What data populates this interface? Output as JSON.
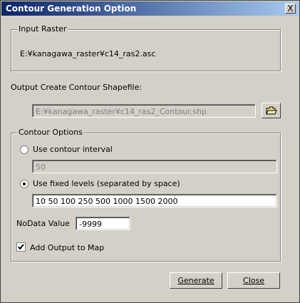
{
  "window": {
    "title": "Contour Generation Option",
    "close_glyph": "X"
  },
  "input_raster": {
    "group_title": "Input Raster",
    "path": "E:¥kanagawa_raster¥c14_ras2.asc"
  },
  "output": {
    "label": "Output Create Contour Shapefile:",
    "path": "E:¥kanagawa_raster¥c14_ras2_Contour.shp",
    "browse_icon": "folder-open-icon"
  },
  "contour_options": {
    "group_title": "Contour Options",
    "interval_label": "Use contour interval",
    "interval_value": "50",
    "interval_selected": false,
    "fixed_label": "Use fixed levels (separated by space)",
    "fixed_value": "10 50 100 250 500 1000 1500 2000",
    "fixed_selected": true,
    "nodata_label": "NoData Value",
    "nodata_value": "-9999",
    "add_to_map_label": "Add Output to Map",
    "add_to_map_checked": true
  },
  "buttons": {
    "generate": "Generate",
    "close": "Close"
  }
}
